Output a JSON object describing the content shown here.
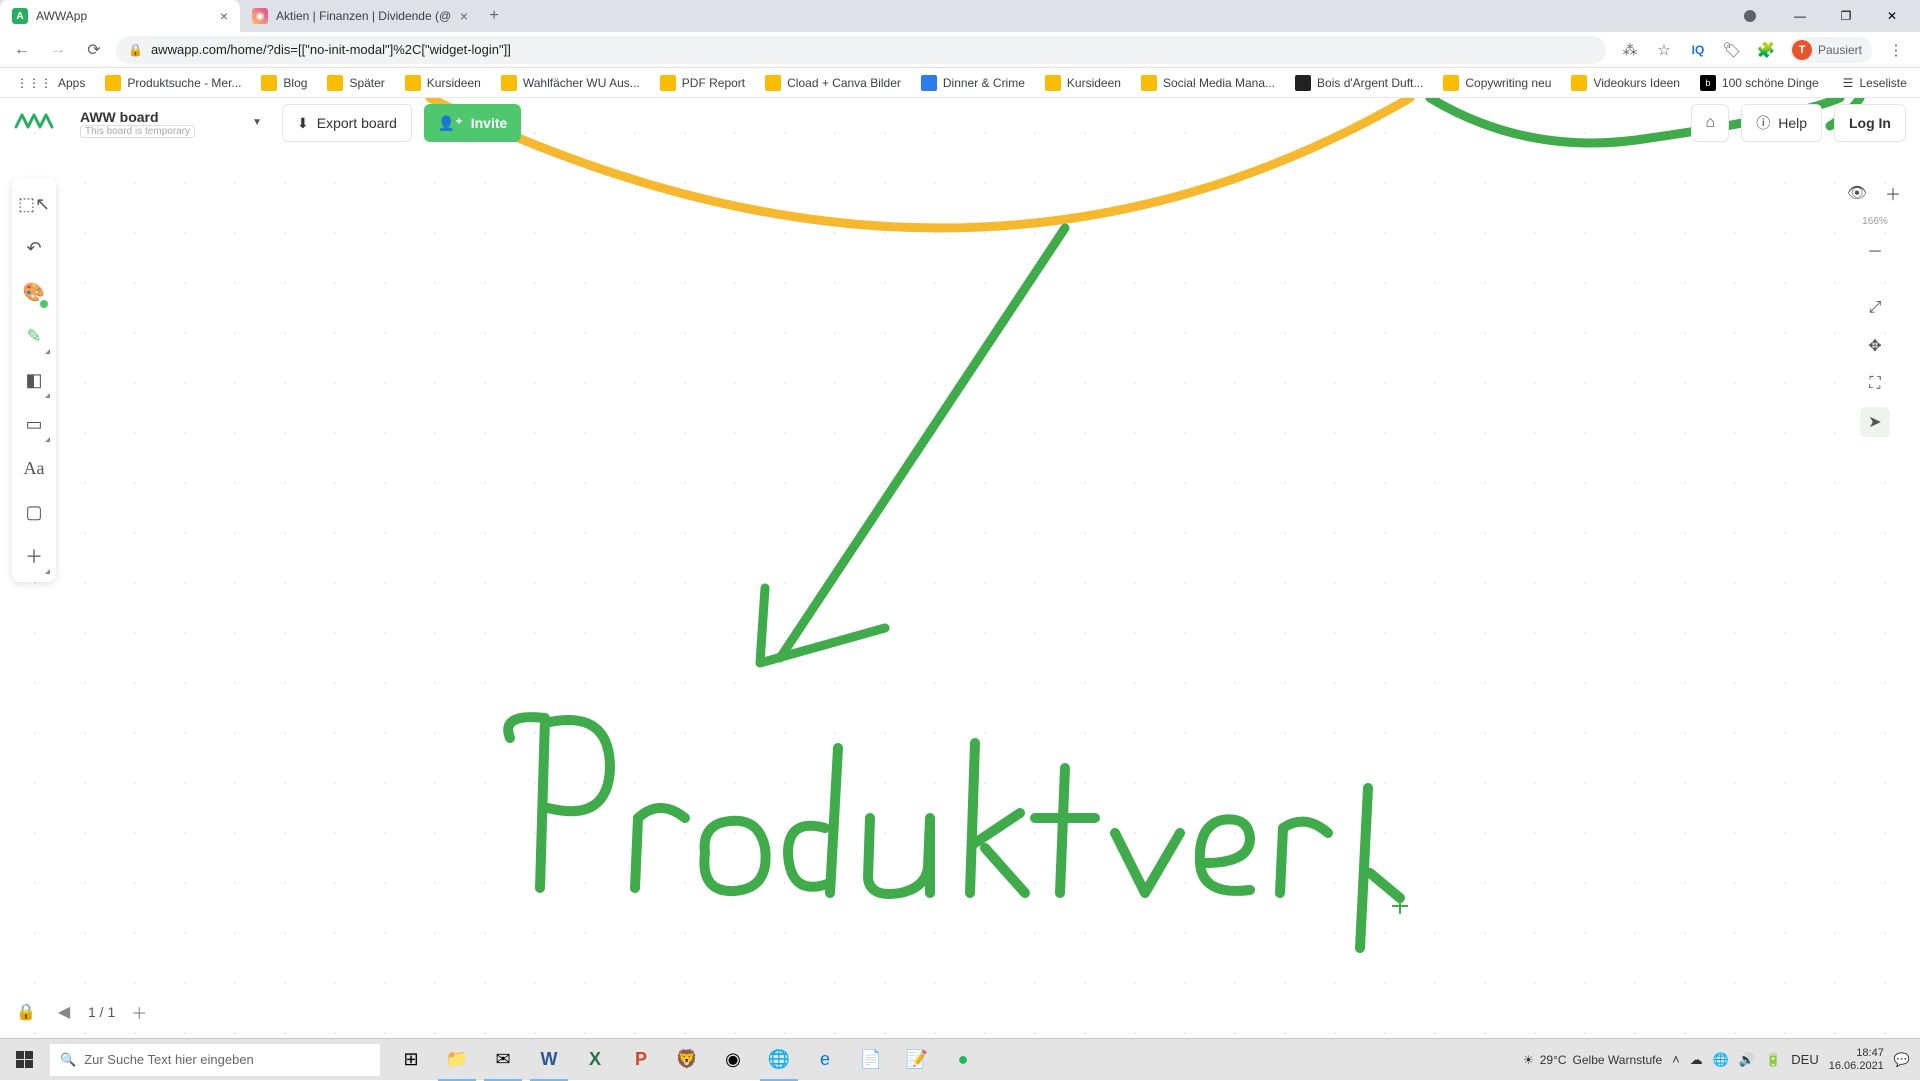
{
  "browser": {
    "tabs": [
      {
        "title": "AWWApp",
        "active": true
      },
      {
        "title": "Aktien | Finanzen | Dividende (@",
        "active": false
      }
    ],
    "url": "awwapp.com/home/?dis=[[\"no-init-modal\"]%2C[\"widget-login\"]]",
    "profile_status": "Pausiert",
    "profile_initial": "T",
    "bookmarks_label": "Apps",
    "bookmarks": [
      "Produktsuche - Mer...",
      "Blog",
      "Später",
      "Kursideen",
      "Wahlfächer WU Aus...",
      "PDF Report",
      "Cload + Canva Bilder",
      "Dinner & Crime",
      "Kursideen",
      "Social Media Mana...",
      "Bois d'Argent Duft...",
      "Copywriting neu",
      "Videokurs Ideen",
      "100 schöne Dinge"
    ],
    "reading_list": "Leseliste"
  },
  "app": {
    "board_name": "AWW board",
    "board_tag": "This board is temporary",
    "export_label": "Export board",
    "invite_label": "Invite",
    "help_label": "Help",
    "login_label": "Log In",
    "zoom_pct": "166%",
    "page_current": "1",
    "page_total": "1"
  },
  "canvas": {
    "handwriting": "Produktverk",
    "strokes": {
      "yellow_arc": "oval arc across top",
      "green_circle_fragment": "top-right",
      "green_arrow": "diagonal arrow pointing down-left",
      "green_text": "Produktverk (handwritten)"
    },
    "colors": {
      "green": "#3fab4a",
      "yellow": "#f5b82e"
    }
  },
  "taskbar": {
    "search_placeholder": "Zur Suche Text hier eingeben",
    "weather_temp": "29°C",
    "weather_status": "Gelbe Warnstufe",
    "lang": "DEU",
    "time": "18:47",
    "date": "16.06.2021"
  }
}
